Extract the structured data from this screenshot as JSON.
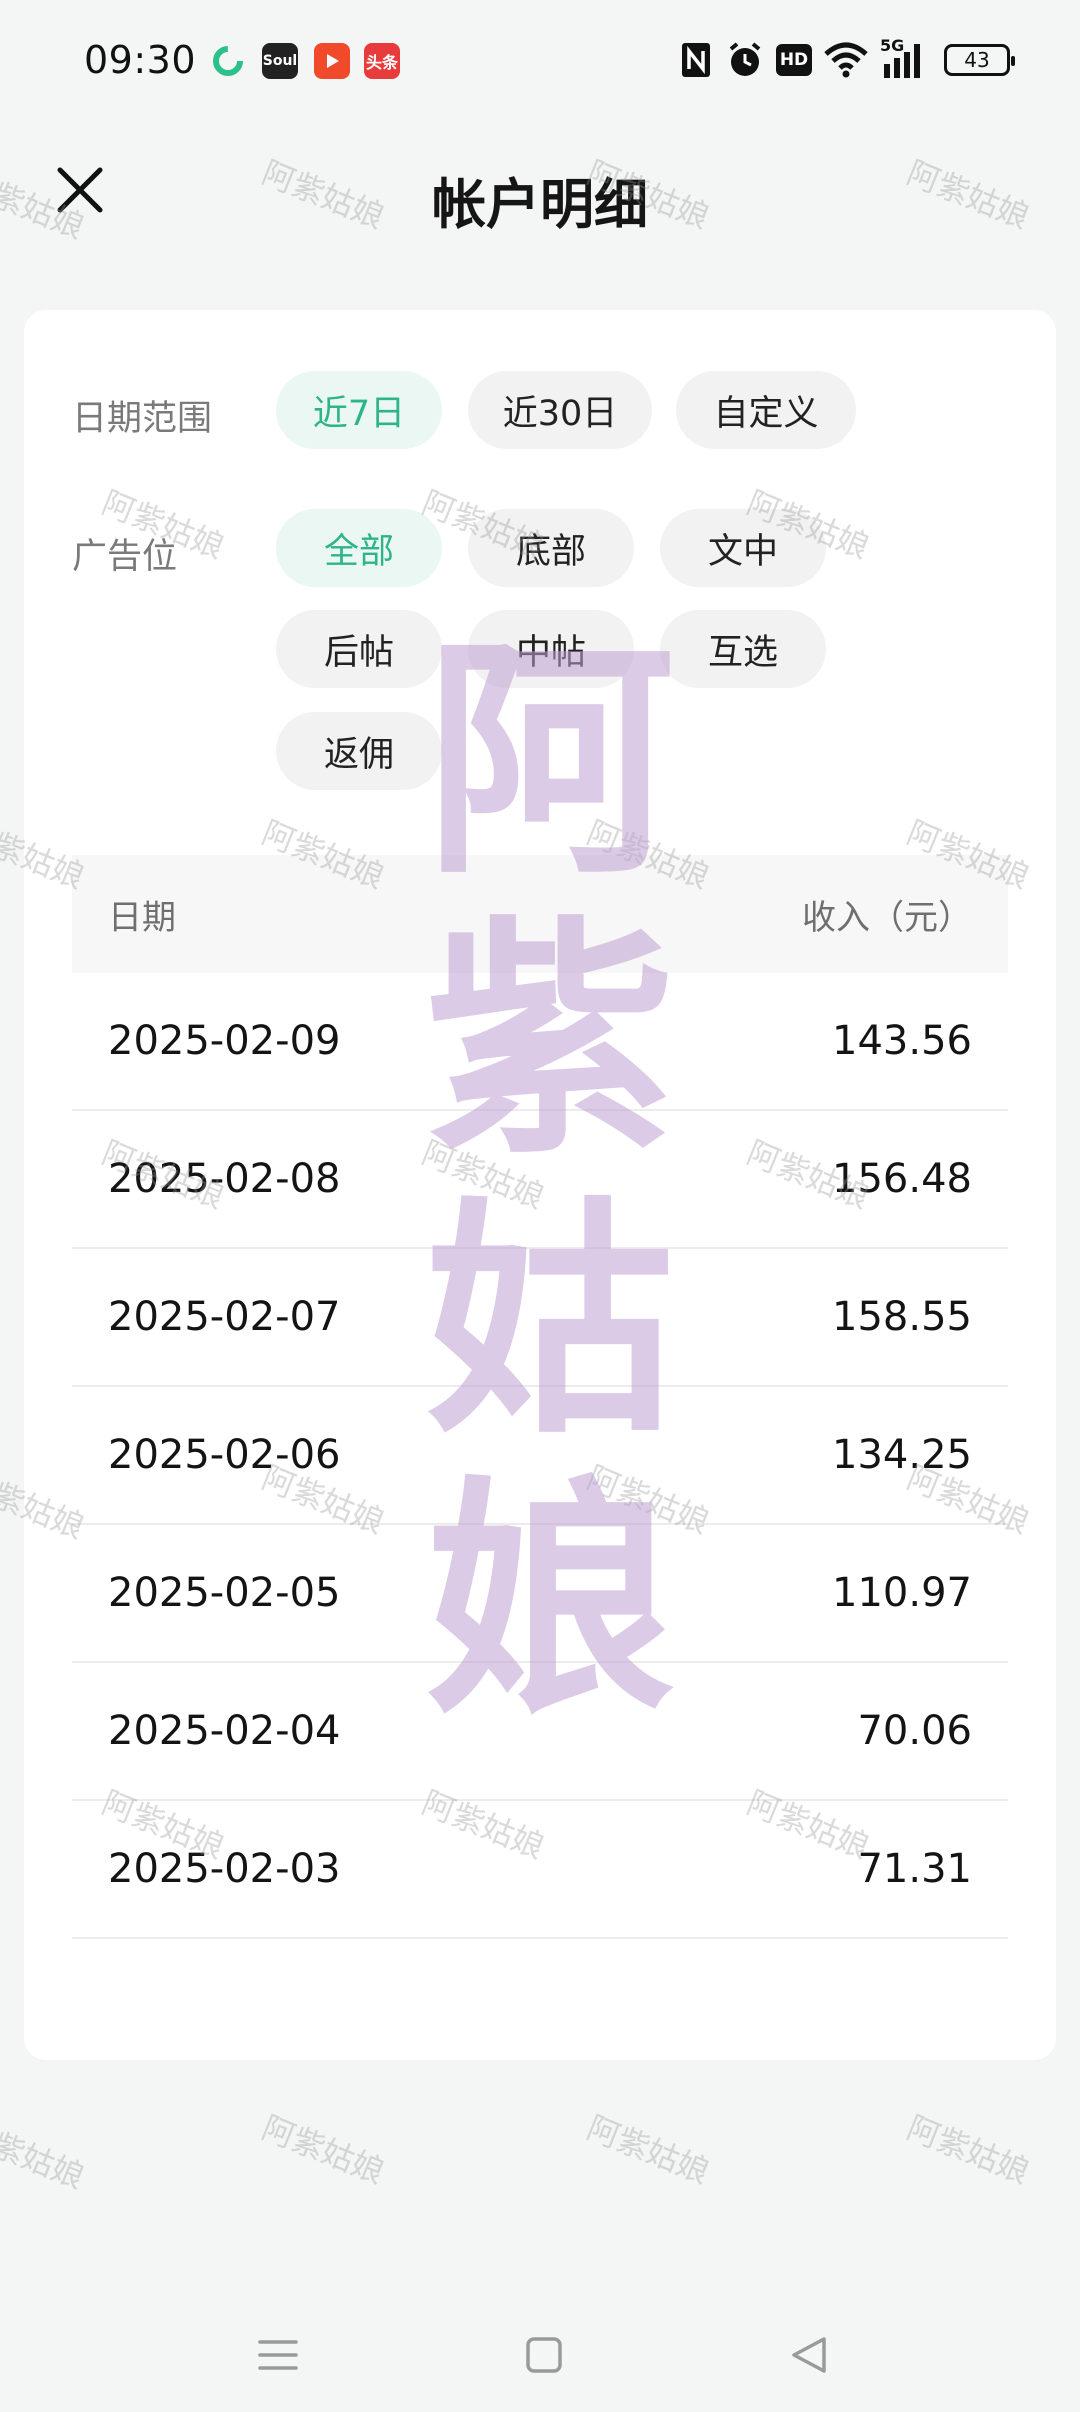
{
  "status_bar": {
    "time": "09:30",
    "app_icons": [
      "green-loop-icon",
      "soul-app-icon",
      "video-play-app-icon",
      "toutiao-app-icon"
    ],
    "soul_label": "Soul",
    "toutiao_label": "头条",
    "indicators": [
      "nfc-icon",
      "alarm-icon",
      "hd-icon",
      "wifi-icon",
      "5g-signal-icon"
    ],
    "hd_label": "HD",
    "network_label": "5G",
    "battery": "43"
  },
  "header": {
    "title": "帐户明细"
  },
  "filters": {
    "date_range_label": "日期范围",
    "date_options": [
      "近7日",
      "近30日",
      "自定义"
    ],
    "selected_date": "近7日",
    "ad_position_label": "广告位",
    "ad_options": [
      "全部",
      "底部",
      "文中",
      "后帖",
      "中帖",
      "互选",
      "返佣"
    ],
    "selected_ad": "全部"
  },
  "table": {
    "columns": [
      "日期",
      "收入（元）"
    ],
    "rows": [
      {
        "date": "2025-02-09",
        "income": "143.56"
      },
      {
        "date": "2025-02-08",
        "income": "156.48"
      },
      {
        "date": "2025-02-07",
        "income": "158.55"
      },
      {
        "date": "2025-02-06",
        "income": "134.25"
      },
      {
        "date": "2025-02-05",
        "income": "110.97"
      },
      {
        "date": "2025-02-04",
        "income": "70.06"
      },
      {
        "date": "2025-02-03",
        "income": "71.31"
      }
    ]
  },
  "watermark": {
    "big": [
      "阿",
      "紫",
      "姑",
      "娘"
    ],
    "small": "阿紫姑娘"
  },
  "colors": {
    "accent": "#2fb38a",
    "active_chip_bg": "#eaf7f2",
    "chip_bg": "#f2f2f2",
    "page_bg": "#f4f6f5"
  },
  "nav_bar": {
    "buttons": [
      "menu-icon",
      "home-icon",
      "back-icon"
    ]
  }
}
